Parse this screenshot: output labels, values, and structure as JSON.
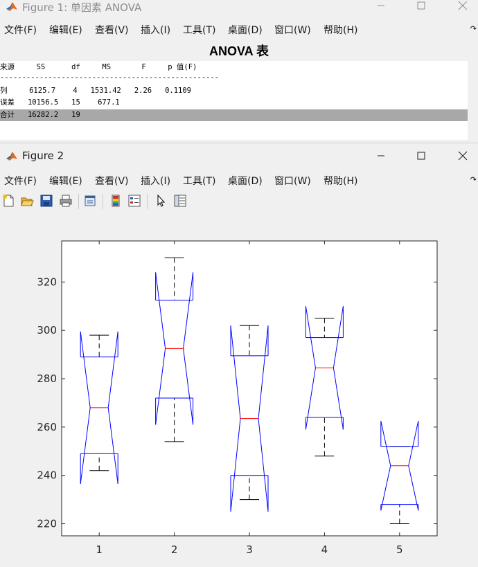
{
  "figure1": {
    "title": "Figure 1: 单因素 ANOVA",
    "menu": [
      "文件(F)",
      "编辑(E)",
      "查看(V)",
      "插入(I)",
      "工具(T)",
      "桌面(D)",
      "窗口(W)",
      "帮助(H)"
    ],
    "heading": "ANOVA 表",
    "table": {
      "header": "来源     SS      df     MS       F     p 值(F)",
      "rule": "--------------------------------------------------",
      "rows": [
        "列     6125.7    4   1531.42   2.26   0.1109",
        "误差   10156.5   15    677.1",
        "合计   16282.2   19"
      ]
    }
  },
  "figure2": {
    "title": "Figure 2",
    "menu": [
      "文件(F)",
      "编辑(E)",
      "查看(V)",
      "插入(I)",
      "工具(T)",
      "桌面(D)",
      "窗口(W)",
      "帮助(H)"
    ],
    "toolbar_icons": [
      "new-figure-icon",
      "open-icon",
      "save-icon",
      "print-icon",
      "link-figure-icon",
      "colorbar-icon",
      "legend-icon",
      "pointer-icon",
      "property-inspector-icon"
    ]
  },
  "colors": {
    "box": "#0000ff",
    "median": "#ff0000",
    "whisker": "#000000"
  },
  "chart_data": {
    "type": "box",
    "notched": true,
    "categories": [
      "1",
      "2",
      "3",
      "4",
      "5"
    ],
    "ylim": [
      215,
      337
    ],
    "yticks": [
      220,
      240,
      260,
      280,
      300,
      320
    ],
    "grid": false,
    "boxes": [
      {
        "label": "1",
        "whisker_low": 242,
        "q1": 249,
        "median": 268,
        "q3": 289,
        "whisker_high": 298,
        "notch_low": 236.5,
        "notch_high": 299.5
      },
      {
        "label": "2",
        "whisker_low": 254,
        "q1": 272,
        "median": 292.5,
        "q3": 312.5,
        "whisker_high": 330,
        "notch_low": 261,
        "notch_high": 324
      },
      {
        "label": "3",
        "whisker_low": 230,
        "q1": 240,
        "median": 263.5,
        "q3": 289.5,
        "whisker_high": 302,
        "notch_low": 225,
        "notch_high": 302
      },
      {
        "label": "4",
        "whisker_low": 248,
        "q1": 264,
        "median": 284.5,
        "q3": 297,
        "whisker_high": 305,
        "notch_low": 259,
        "notch_high": 310
      },
      {
        "label": "5",
        "whisker_low": 220,
        "q1": 228,
        "median": 244,
        "q3": 252,
        "whisker_high": 252,
        "notch_low": 225.5,
        "notch_high": 262.5
      }
    ]
  }
}
